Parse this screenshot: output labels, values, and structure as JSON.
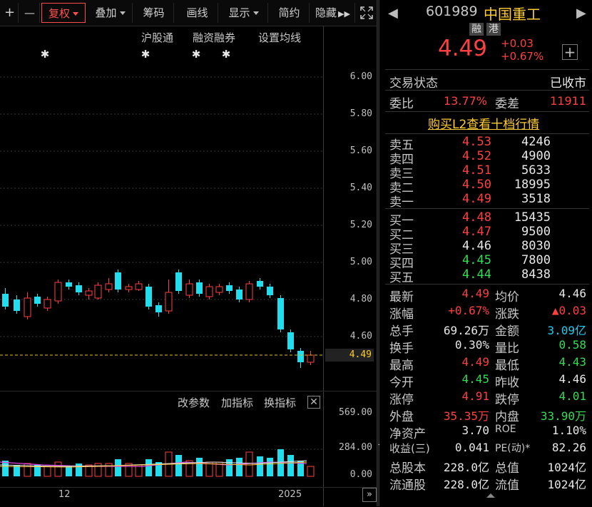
{
  "toolbar": {
    "plus": "+",
    "minus": "—",
    "fuquan": "复权",
    "diejia": "叠加",
    "chouma": "筹码",
    "huaxian": "画线",
    "xianshi": "显示",
    "jianyue": "简约",
    "yincang": "隐藏"
  },
  "chart": {
    "links": {
      "hgt": "沪股通",
      "rzrq": "融资融券",
      "set_ma": "设置均线"
    },
    "star": "✱",
    "price_ticks": [
      "6.00",
      "5.80",
      "5.60",
      "5.40",
      "5.20",
      "5.00",
      "4.80",
      "4.60"
    ],
    "current_price_tag": "4.49",
    "colors": {
      "up": "#ff4040",
      "down": "#22ddee",
      "ma": "#dd44dd",
      "ma2": "#e8e8e8",
      "ma3": "#ffcc33"
    }
  },
  "volume": {
    "links": {
      "modify": "改参数",
      "add": "加指标",
      "change": "换指标"
    },
    "close": "✕",
    "ticks": [
      "569.00",
      "284.00",
      "0.00"
    ],
    "dates": [
      "12",
      "2025"
    ]
  },
  "quote": {
    "code": "601989",
    "name": "中国重工",
    "badge_rong": "融",
    "badge_gang": "港",
    "price": "4.49",
    "change": "+0.03",
    "change_pct": "+0.67%",
    "status_label": "交易状态",
    "status_value": "已收市",
    "weibi_label": "委比",
    "weibi_value": "13.77%",
    "weicha_label": "委差",
    "weicha_value": "11911",
    "l2_link": "购买L2查看十档行情"
  },
  "orderbook": {
    "asks": [
      {
        "label": "卖五",
        "price": "4.53",
        "vol": "4246"
      },
      {
        "label": "卖四",
        "price": "4.52",
        "vol": "4900"
      },
      {
        "label": "卖三",
        "price": "4.51",
        "vol": "5633"
      },
      {
        "label": "卖二",
        "price": "4.50",
        "vol": "18995"
      },
      {
        "label": "卖一",
        "price": "4.49",
        "vol": "3518"
      }
    ],
    "bids": [
      {
        "label": "买一",
        "price": "4.48",
        "vol": "15435"
      },
      {
        "label": "买二",
        "price": "4.47",
        "vol": "9500"
      },
      {
        "label": "买三",
        "price": "4.46",
        "vol": "8030"
      },
      {
        "label": "买四",
        "price": "4.45",
        "vol": "7800"
      },
      {
        "label": "买五",
        "price": "4.44",
        "vol": "8438"
      }
    ]
  },
  "stats": {
    "zuixin": {
      "l": "最新",
      "v": "4.49"
    },
    "junjia": {
      "l": "均价",
      "v": "4.46"
    },
    "zhangfu": {
      "l": "涨幅",
      "v": "+0.67%"
    },
    "zhangdie": {
      "l": "涨跌",
      "v": "▲0.03"
    },
    "zongshou": {
      "l": "总手",
      "v": "69.26万"
    },
    "jine": {
      "l": "金额",
      "v": "3.09亿"
    },
    "huanshou": {
      "l": "换手",
      "v": "0.30%"
    },
    "liangbi": {
      "l": "量比",
      "v": "0.58"
    },
    "zuigao": {
      "l": "最高",
      "v": "4.49"
    },
    "zuidi": {
      "l": "最低",
      "v": "4.43"
    },
    "jinkai": {
      "l": "今开",
      "v": "4.45"
    },
    "zuoshou": {
      "l": "昨收",
      "v": "4.46"
    },
    "zhangting": {
      "l": "涨停",
      "v": "4.91"
    },
    "dieting": {
      "l": "跌停",
      "v": "4.01"
    },
    "waipan": {
      "l": "外盘",
      "v": "35.35万"
    },
    "neipan": {
      "l": "内盘",
      "v": "33.90万"
    },
    "jingzichan": {
      "l": "净资产",
      "v": "3.70"
    },
    "roe": {
      "l": "ROE",
      "v": "1.10%"
    },
    "shouyi": {
      "l": "收益(三)",
      "v": "0.041"
    },
    "pe": {
      "l": "PE(动)*",
      "v": "82.26"
    },
    "zongguben": {
      "l": "总股本",
      "v": "228.0亿"
    },
    "zongzhi": {
      "l": "总值",
      "v": "1024亿"
    },
    "liutonggu": {
      "l": "流通股",
      "v": "228.0亿"
    },
    "liuzhi": {
      "l": "流值",
      "v": "1024亿"
    }
  }
}
